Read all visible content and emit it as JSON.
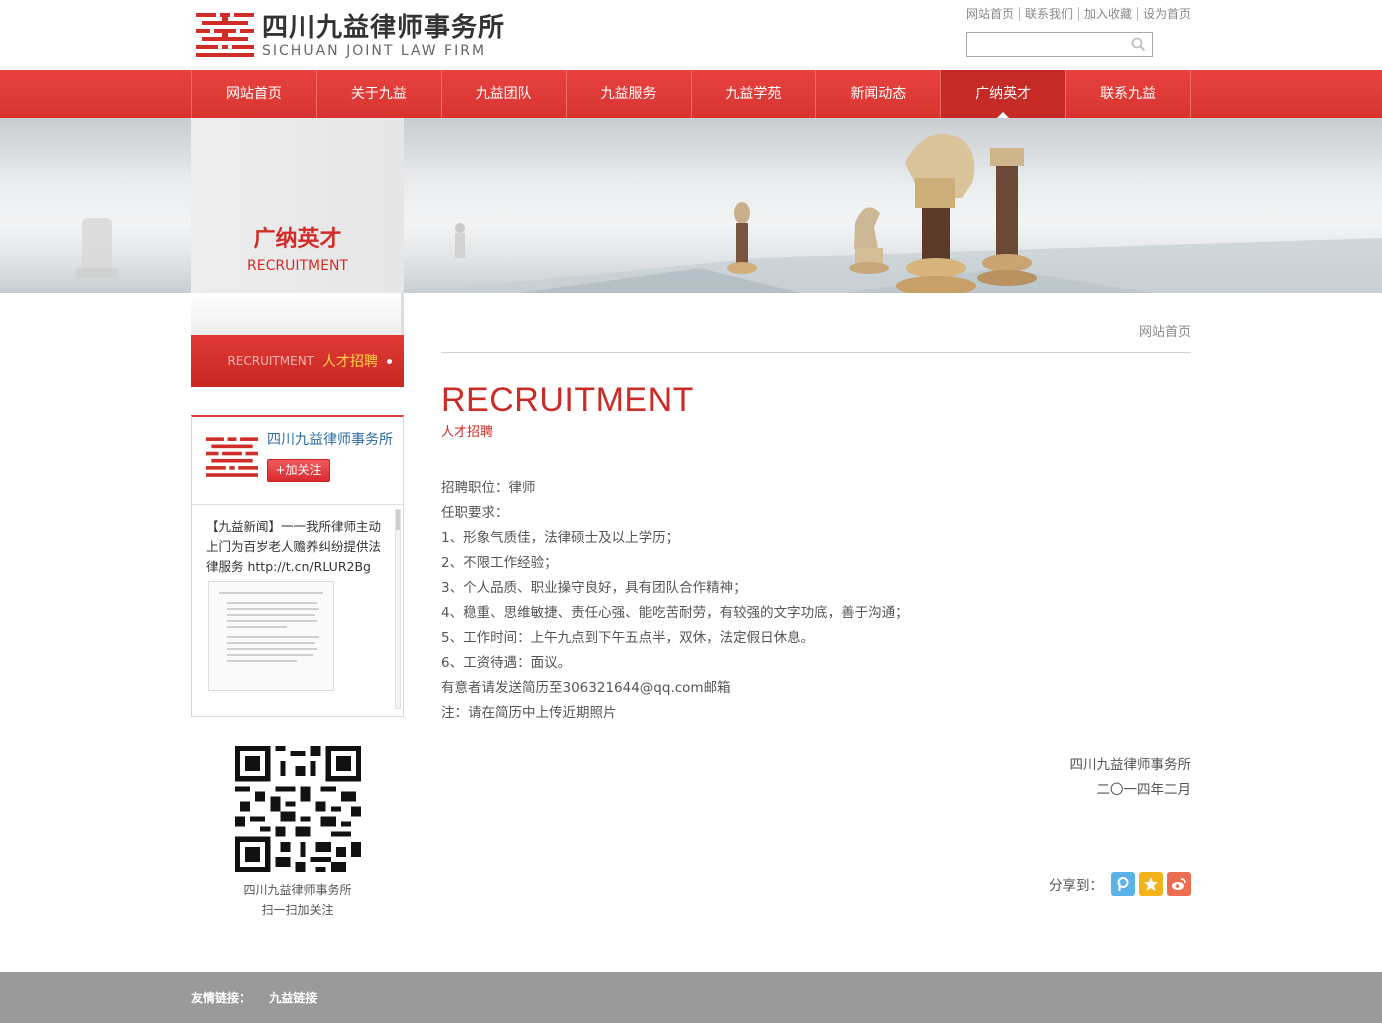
{
  "header": {
    "logo_cn": "四川九益律师事务所",
    "logo_en": "SICHUAN JOINT LAW FIRM",
    "top_links": [
      "网站首页",
      "联系我们",
      "加入收藏",
      "设为首页"
    ],
    "search": {
      "value": "",
      "placeholder": ""
    }
  },
  "nav": {
    "items": [
      "网站首页",
      "关于九益",
      "九益团队",
      "九益服务",
      "九益学苑",
      "新闻动态",
      "广纳英才",
      "联系九益"
    ],
    "active_index": 6
  },
  "banner": {
    "title_cn": "广纳英才",
    "title_en": "RECRUITMENT"
  },
  "sidebar": {
    "menu": {
      "en": "RECRUITMENT",
      "cn": "人才招聘"
    },
    "weibo": {
      "name": "四川九益律师事务所",
      "follow_label": "+加关注",
      "post": "【九益新闻】一一我所律师主动上门为百岁老人赡养纠纷提供法律服务 http://t.cn/RLUR2Bg"
    },
    "qr": {
      "caption_line1": "四川九益律师事务所",
      "caption_line2": "扫一扫加关注"
    }
  },
  "main": {
    "breadcrumb": "网站首页",
    "title_en": "RECRUITMENT",
    "title_cn": "人才招聘",
    "lines": [
      "招聘职位：律师",
      "任职要求：",
      "1、形象气质佳，法律硕士及以上学历；",
      "2、不限工作经验；",
      "3、个人品质、职业操守良好，具有团队合作精神；",
      "4、稳重、思维敏捷、责任心强、能吃苦耐劳，有较强的文字功底，善于沟通；",
      "5、工作时间：上午九点到下午五点半，双休，法定假日休息。",
      "6、工资待遇：面议。",
      "有意者请发送简历至306321644@qq.com邮箱",
      "注：请在简历中上传近期照片"
    ],
    "sign_org": "四川九益律师事务所",
    "sign_date": "二〇一四年二月",
    "share_label": "分享到："
  },
  "footer": {
    "label": "友情链接：",
    "link": "九益链接"
  },
  "colors": {
    "brand_red": "#d73430",
    "nav_active": "#c52a26",
    "title_red": "#cc2c27",
    "footer_gray": "#9a9a9a"
  },
  "icons": [
    "search-icon",
    "share-icon-qzone",
    "share-icon-favorite",
    "share-icon-weibo"
  ]
}
